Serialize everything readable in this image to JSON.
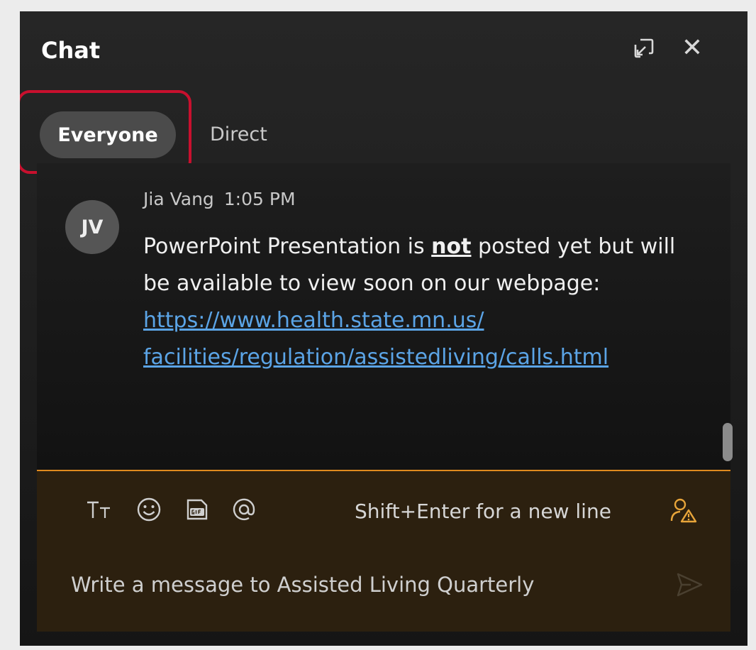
{
  "header": {
    "title": "Chat",
    "popout_icon": "popout-icon",
    "close_icon": "close-icon",
    "close_glyph": "✕"
  },
  "tabs": [
    {
      "label": "Everyone",
      "selected": true
    },
    {
      "label": "Direct",
      "selected": false
    }
  ],
  "messages": [
    {
      "initials": "JV",
      "sender": "Jia Vang",
      "time": "1:05 PM",
      "text_before": "PowerPoint Presentation is ",
      "emphasis": "not",
      "text_middle": " posted yet but will be available to view soon on our webpage: ",
      "link": "https://www.health.state.mn.us/facilities/regulation/assistedliving/calls.html",
      "link_line1": "https://www.health.state.mn.us/",
      "link_line2": "facilities/regulation/assistedliving/calls.html"
    }
  ],
  "composer": {
    "tools": [
      "text-format-icon",
      "emoji-icon",
      "gif-icon",
      "mention-icon"
    ],
    "hint": "Shift+Enter for a new line",
    "warning_icon": "person-warning-icon",
    "placeholder": "Write a message to Assisted Living Quarterly",
    "value": "",
    "send_icon": "send-icon"
  },
  "colors": {
    "accent": "#e08a1e",
    "highlight_box": "#c8102e",
    "link": "#5ba4e6",
    "panel_bg": "#1e1e1e",
    "composer_bg": "#2c200f"
  }
}
